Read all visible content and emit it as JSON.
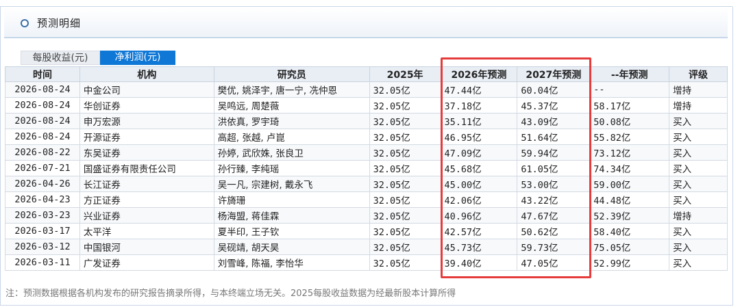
{
  "header": {
    "title": "预测明细"
  },
  "tabs": [
    {
      "label": "每股收益(元)",
      "active": false
    },
    {
      "label": "净利润(元)",
      "active": true
    }
  ],
  "columns": [
    "时间",
    "机构",
    "研究员",
    "2025年",
    "2026年预测",
    "2027年预测",
    "--年预测",
    "评级"
  ],
  "rows": [
    [
      "2026-08-24",
      "中金公司",
      "樊优, 姚泽宇, 唐一宁, 冼仲恩",
      "32.05亿",
      "47.44亿",
      "60.04亿",
      "--",
      "增持"
    ],
    [
      "2026-08-24",
      "华创证券",
      "吴鸣远, 周楚薇",
      "32.05亿",
      "37.18亿",
      "45.37亿",
      "58.17亿",
      "增持"
    ],
    [
      "2026-08-24",
      "申万宏源",
      "洪依真, 罗宇琦",
      "32.05亿",
      "35.11亿",
      "43.09亿",
      "50.08亿",
      "买入"
    ],
    [
      "2026-08-24",
      "开源证券",
      "高超, 张越, 卢崑",
      "32.05亿",
      "46.95亿",
      "51.64亿",
      "55.82亿",
      "买入"
    ],
    [
      "2026-08-22",
      "东吴证券",
      "孙婷, 武欣姝, 张良卫",
      "32.05亿",
      "47.09亿",
      "59.94亿",
      "73.12亿",
      "买入"
    ],
    [
      "2026-07-21",
      "国盛证券有限责任公司",
      "孙行臻, 李纯瑶",
      "32.05亿",
      "45.68亿",
      "61.05亿",
      "74.34亿",
      "买入"
    ],
    [
      "2026-04-26",
      "长江证券",
      "吴一凡, 宗建树, 戴永飞",
      "32.05亿",
      "45.00亿",
      "53.00亿",
      "59.00亿",
      "买入"
    ],
    [
      "2026-04-23",
      "方正证券",
      "许旖珊",
      "32.05亿",
      "42.06亿",
      "43.22亿",
      "44.48亿",
      "买入"
    ],
    [
      "2026-03-23",
      "兴业证券",
      "杨海盟, 蒋佳霖",
      "32.05亿",
      "40.96亿",
      "47.67亿",
      "52.39亿",
      "增持"
    ],
    [
      "2026-03-17",
      "太平洋",
      "夏半印, 王子钦",
      "32.05亿",
      "42.57亿",
      "50.62亿",
      "58.40亿",
      "买入"
    ],
    [
      "2026-03-12",
      "中国银河",
      "吴砚靖, 胡天昊",
      "32.05亿",
      "45.73亿",
      "59.73亿",
      "75.05亿",
      "买入"
    ],
    [
      "2026-03-11",
      "广发证券",
      "刘雪峰, 陈福, 李怡华",
      "32.05亿",
      "39.40亿",
      "47.05亿",
      "52.99亿",
      "买入"
    ]
  ],
  "note": "注：预测数据根据各机构发布的研究报告摘录所得，与本终端立场无关。2025每股收益数据为经最新股本计算所得",
  "colors": {
    "accent": "#0f77d6",
    "highlight": "#e63b3b"
  }
}
